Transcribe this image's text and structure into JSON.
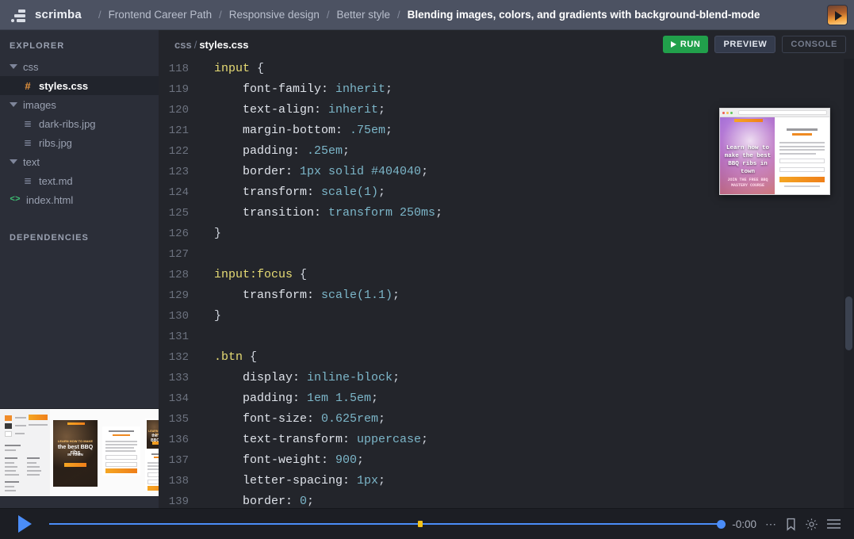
{
  "topbar": {
    "brand": "scrimba",
    "logo_icon": "scrimba-logo-icon",
    "separator": "/",
    "breadcrumbs": [
      {
        "label": "Frontend Career Path",
        "active": false
      },
      {
        "label": "Responsive design",
        "active": false
      },
      {
        "label": "Better style",
        "active": false
      },
      {
        "label": "Blending images, colors, and gradients with background-blend-mode",
        "active": true
      }
    ],
    "avatar_icon": "play-avatar-icon"
  },
  "sidebar": {
    "explorer_title": "EXPLORER",
    "dependencies_title": "DEPENDENCIES",
    "tree": [
      {
        "label": "css",
        "type": "folder",
        "icon": "caret-down-icon",
        "depth": 0,
        "selected": false
      },
      {
        "label": "styles.css",
        "type": "file",
        "icon": "hash-icon",
        "depth": 1,
        "selected": true
      },
      {
        "label": "images",
        "type": "folder",
        "icon": "caret-down-icon",
        "depth": 0,
        "selected": false
      },
      {
        "label": "dark-ribs.jpg",
        "type": "file",
        "icon": "lines-icon",
        "depth": 1,
        "selected": false
      },
      {
        "label": "ribs.jpg",
        "type": "file",
        "icon": "lines-icon",
        "depth": 1,
        "selected": false
      },
      {
        "label": "text",
        "type": "folder",
        "icon": "caret-down-icon",
        "depth": 0,
        "selected": false
      },
      {
        "label": "text.md",
        "type": "file",
        "icon": "lines-icon",
        "depth": 1,
        "selected": false
      },
      {
        "label": "index.html",
        "type": "file",
        "icon": "code-brackets-icon",
        "depth": 0,
        "selected": false
      }
    ]
  },
  "editor": {
    "path_folder": "css",
    "path_separator": "/",
    "path_file": "styles.css",
    "run_label": "RUN",
    "preview_label": "PREVIEW",
    "console_label": "CONSOLE",
    "run_icon": "play-icon",
    "first_line_number": 118,
    "lines": [
      {
        "n": 118,
        "tokens": [
          {
            "t": "input ",
            "c": "sel"
          },
          {
            "t": "{",
            "c": "pun"
          }
        ]
      },
      {
        "n": 119,
        "tokens": [
          {
            "t": "    font-family: ",
            "c": "prop"
          },
          {
            "t": "inherit",
            "c": "val"
          },
          {
            "t": ";",
            "c": "pun"
          }
        ]
      },
      {
        "n": 120,
        "tokens": [
          {
            "t": "    text-align: ",
            "c": "prop"
          },
          {
            "t": "inherit",
            "c": "val"
          },
          {
            "t": ";",
            "c": "pun"
          }
        ]
      },
      {
        "n": 121,
        "tokens": [
          {
            "t": "    margin-bottom: ",
            "c": "prop"
          },
          {
            "t": ".75em",
            "c": "val"
          },
          {
            "t": ";",
            "c": "pun"
          }
        ]
      },
      {
        "n": 122,
        "tokens": [
          {
            "t": "    padding: ",
            "c": "prop"
          },
          {
            "t": ".25em",
            "c": "val"
          },
          {
            "t": ";",
            "c": "pun"
          }
        ]
      },
      {
        "n": 123,
        "tokens": [
          {
            "t": "    border: ",
            "c": "prop"
          },
          {
            "t": "1px solid #404040",
            "c": "val"
          },
          {
            "t": ";",
            "c": "pun"
          }
        ]
      },
      {
        "n": 124,
        "tokens": [
          {
            "t": "    transform: ",
            "c": "prop"
          },
          {
            "t": "scale(1)",
            "c": "val"
          },
          {
            "t": ";",
            "c": "pun"
          }
        ]
      },
      {
        "n": 125,
        "tokens": [
          {
            "t": "    transition: ",
            "c": "prop"
          },
          {
            "t": "transform 250ms",
            "c": "val"
          },
          {
            "t": ";",
            "c": "pun"
          }
        ]
      },
      {
        "n": 126,
        "tokens": [
          {
            "t": "}",
            "c": "pun"
          }
        ]
      },
      {
        "n": 127,
        "tokens": [
          {
            "t": "",
            "c": "pun"
          }
        ]
      },
      {
        "n": 128,
        "tokens": [
          {
            "t": "input:focus ",
            "c": "sel"
          },
          {
            "t": "{",
            "c": "pun"
          }
        ]
      },
      {
        "n": 129,
        "tokens": [
          {
            "t": "    transform: ",
            "c": "prop"
          },
          {
            "t": "scale(1.1)",
            "c": "val"
          },
          {
            "t": ";",
            "c": "pun"
          }
        ]
      },
      {
        "n": 130,
        "tokens": [
          {
            "t": "}",
            "c": "pun"
          }
        ]
      },
      {
        "n": 131,
        "tokens": [
          {
            "t": "",
            "c": "pun"
          }
        ]
      },
      {
        "n": 132,
        "tokens": [
          {
            "t": ".btn ",
            "c": "sel"
          },
          {
            "t": "{",
            "c": "pun"
          }
        ]
      },
      {
        "n": 133,
        "tokens": [
          {
            "t": "    display: ",
            "c": "prop"
          },
          {
            "t": "inline-block",
            "c": "val"
          },
          {
            "t": ";",
            "c": "pun"
          }
        ]
      },
      {
        "n": 134,
        "tokens": [
          {
            "t": "    padding: ",
            "c": "prop"
          },
          {
            "t": "1em 1.5em",
            "c": "val"
          },
          {
            "t": ";",
            "c": "pun"
          }
        ]
      },
      {
        "n": 135,
        "tokens": [
          {
            "t": "    font-size: ",
            "c": "prop"
          },
          {
            "t": "0.625rem",
            "c": "val"
          },
          {
            "t": ";",
            "c": "pun"
          }
        ]
      },
      {
        "n": 136,
        "tokens": [
          {
            "t": "    text-transform: ",
            "c": "prop"
          },
          {
            "t": "uppercase",
            "c": "val"
          },
          {
            "t": ";",
            "c": "pun"
          }
        ]
      },
      {
        "n": 137,
        "tokens": [
          {
            "t": "    font-weight: ",
            "c": "prop"
          },
          {
            "t": "900",
            "c": "val"
          },
          {
            "t": ";",
            "c": "pun"
          }
        ]
      },
      {
        "n": 138,
        "tokens": [
          {
            "t": "    letter-spacing: ",
            "c": "prop"
          },
          {
            "t": "1px",
            "c": "val"
          },
          {
            "t": ";",
            "c": "pun"
          }
        ]
      },
      {
        "n": 139,
        "tokens": [
          {
            "t": "    border: ",
            "c": "prop"
          },
          {
            "t": "0",
            "c": "val"
          },
          {
            "t": ";",
            "c": "pun"
          }
        ]
      }
    ]
  },
  "preview_popup": {
    "name": "live-preview-window",
    "hero_heading": "Learn how to make the best BBQ ribs in town",
    "hero_sub": "JOIN THE FREE BBQ MASTERY COURSE"
  },
  "design_thumbnail": {
    "name": "design-mockup-thumbnail",
    "hero_heading": "the best BBQ ribs"
  },
  "player": {
    "play_icon": "play-icon",
    "time_remaining": "-0:00",
    "dots_icon": "more-options-icon",
    "bookmark_icon": "bookmark-icon",
    "gear_icon": "settings-gear-icon",
    "menu_icon": "hamburger-menu-icon",
    "progress_percent": 100,
    "marker_percent": 55
  },
  "colors": {
    "topbar_bg": "#4c5262",
    "sidebar_bg": "#2b2e38",
    "editor_bg": "#23252b",
    "player_bg": "#1c1e24",
    "accent_blue": "#4b8df8",
    "run_green": "#21a04b",
    "marker_yellow": "#f2c218",
    "orange": "#e8953d",
    "selector_yellow": "#e6db74",
    "value_teal": "#7cb6c9"
  }
}
